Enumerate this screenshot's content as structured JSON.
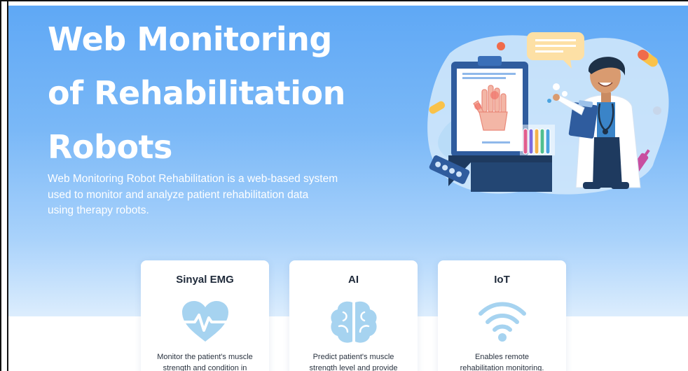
{
  "hero": {
    "title": "Web Monitoring of Rehabilitation Robots",
    "title_lines": [
      "Web Monitoring",
      "of Rehabilitation",
      "Robots"
    ],
    "description_lines": [
      "Web Monitoring Robot Rehabilitation is a web-based system",
      "used to monitor and analyze patient rehabilitation data",
      "using therapy robots."
    ],
    "illustration": "doctor-with-xray-illustration"
  },
  "features": [
    {
      "title": "Sinyal EMG",
      "icon": "heart-pulse-icon",
      "text_lines": [
        "Monitor the patient's muscle",
        "strength and condition in"
      ]
    },
    {
      "title": "AI",
      "icon": "brain-icon",
      "text_lines": [
        "Predict patient's muscle",
        "strength level and provide"
      ]
    },
    {
      "title": "IoT",
      "icon": "wifi-icon",
      "text_lines": [
        "Enables remote",
        "rehabilitation monitoring."
      ]
    }
  ],
  "colors": {
    "hero_top": "#5fa8f5",
    "hero_bottom": "#dcedfd",
    "icon_blue": "#9fcdef",
    "card_bg": "#ffffff",
    "text_dark": "#1f2a3a"
  }
}
